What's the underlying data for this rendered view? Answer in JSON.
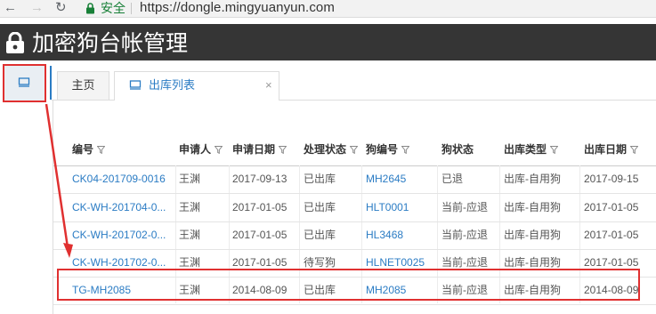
{
  "browser": {
    "secure_label": "安全",
    "url": "https://dongle.mingyuanyun.com"
  },
  "app": {
    "title": "加密狗台帐管理"
  },
  "tabs": [
    {
      "label": "主页"
    },
    {
      "label": "出库列表",
      "close": "×"
    }
  ],
  "table": {
    "columns": [
      "编号",
      "申请人",
      "申请日期",
      "处理状态",
      "狗编号",
      "狗状态",
      "出库类型",
      "出库日期"
    ],
    "rows": [
      [
        "CK04-201709-0016",
        "王渊",
        "2017-09-13",
        "已出库",
        "MH2645",
        "已退",
        "出库-自用狗",
        "2017-09-15"
      ],
      [
        "CK-WH-201704-0...",
        "王渊",
        "2017-01-05",
        "已出库",
        "HLT0001",
        "当前-应退",
        "出库-自用狗",
        "2017-01-05"
      ],
      [
        "CK-WH-201702-0...",
        "王渊",
        "2017-01-05",
        "已出库",
        "HL3468",
        "当前-应退",
        "出库-自用狗",
        "2017-01-05"
      ],
      [
        "CK-WH-201702-0...",
        "王渊",
        "2017-01-05",
        "待写狗",
        "HLNET0025",
        "当前-应退",
        "出库-自用狗",
        "2017-01-05"
      ],
      [
        "TG-MH2085",
        "王渊",
        "2014-08-09",
        "已出库",
        "MH2085",
        "当前-应退",
        "出库-自用狗",
        "2014-08-09"
      ]
    ]
  },
  "colors": {
    "accent": "#2b7cc4",
    "highlight": "#e03030",
    "header_bg": "#353535"
  }
}
